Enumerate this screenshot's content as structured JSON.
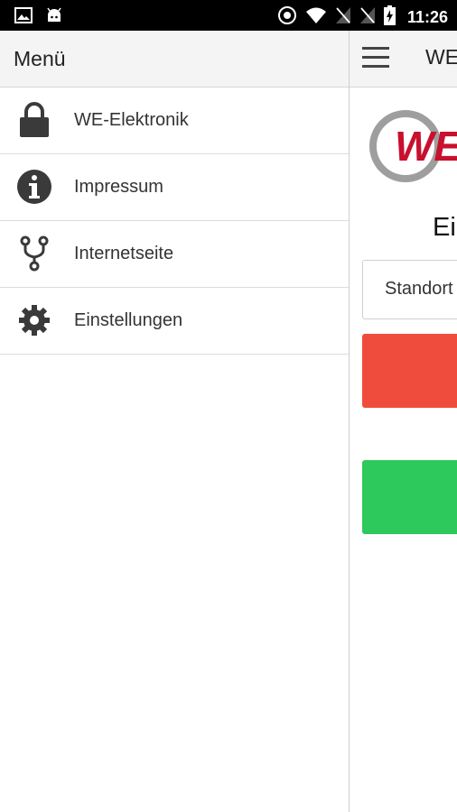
{
  "status_bar": {
    "time": "11:26",
    "left_icons": [
      "image-icon",
      "android-icon"
    ],
    "right_icons": [
      "sync-icon",
      "wifi-icon",
      "no-signal-icon",
      "no-signal-icon",
      "battery-charging-icon"
    ]
  },
  "drawer": {
    "title": "Menü",
    "items": [
      {
        "label": "WE-Elektronik",
        "icon": "lock-icon"
      },
      {
        "label": "Impressum",
        "icon": "info-icon"
      },
      {
        "label": "Internetseite",
        "icon": "fork-icon"
      },
      {
        "label": "Einstellungen",
        "icon": "gear-icon"
      }
    ]
  },
  "main": {
    "title": "WE",
    "logo_text": "WE",
    "heading": "Ei",
    "select_value": "Standort",
    "buttons": [
      {
        "color": "#f04c3e"
      },
      {
        "color": "#2ec95c"
      }
    ]
  },
  "colors": {
    "brand_red": "#c8102e",
    "brand_gray": "#9e9e9e",
    "button_red": "#f04c3e",
    "button_green": "#2ec95c"
  }
}
